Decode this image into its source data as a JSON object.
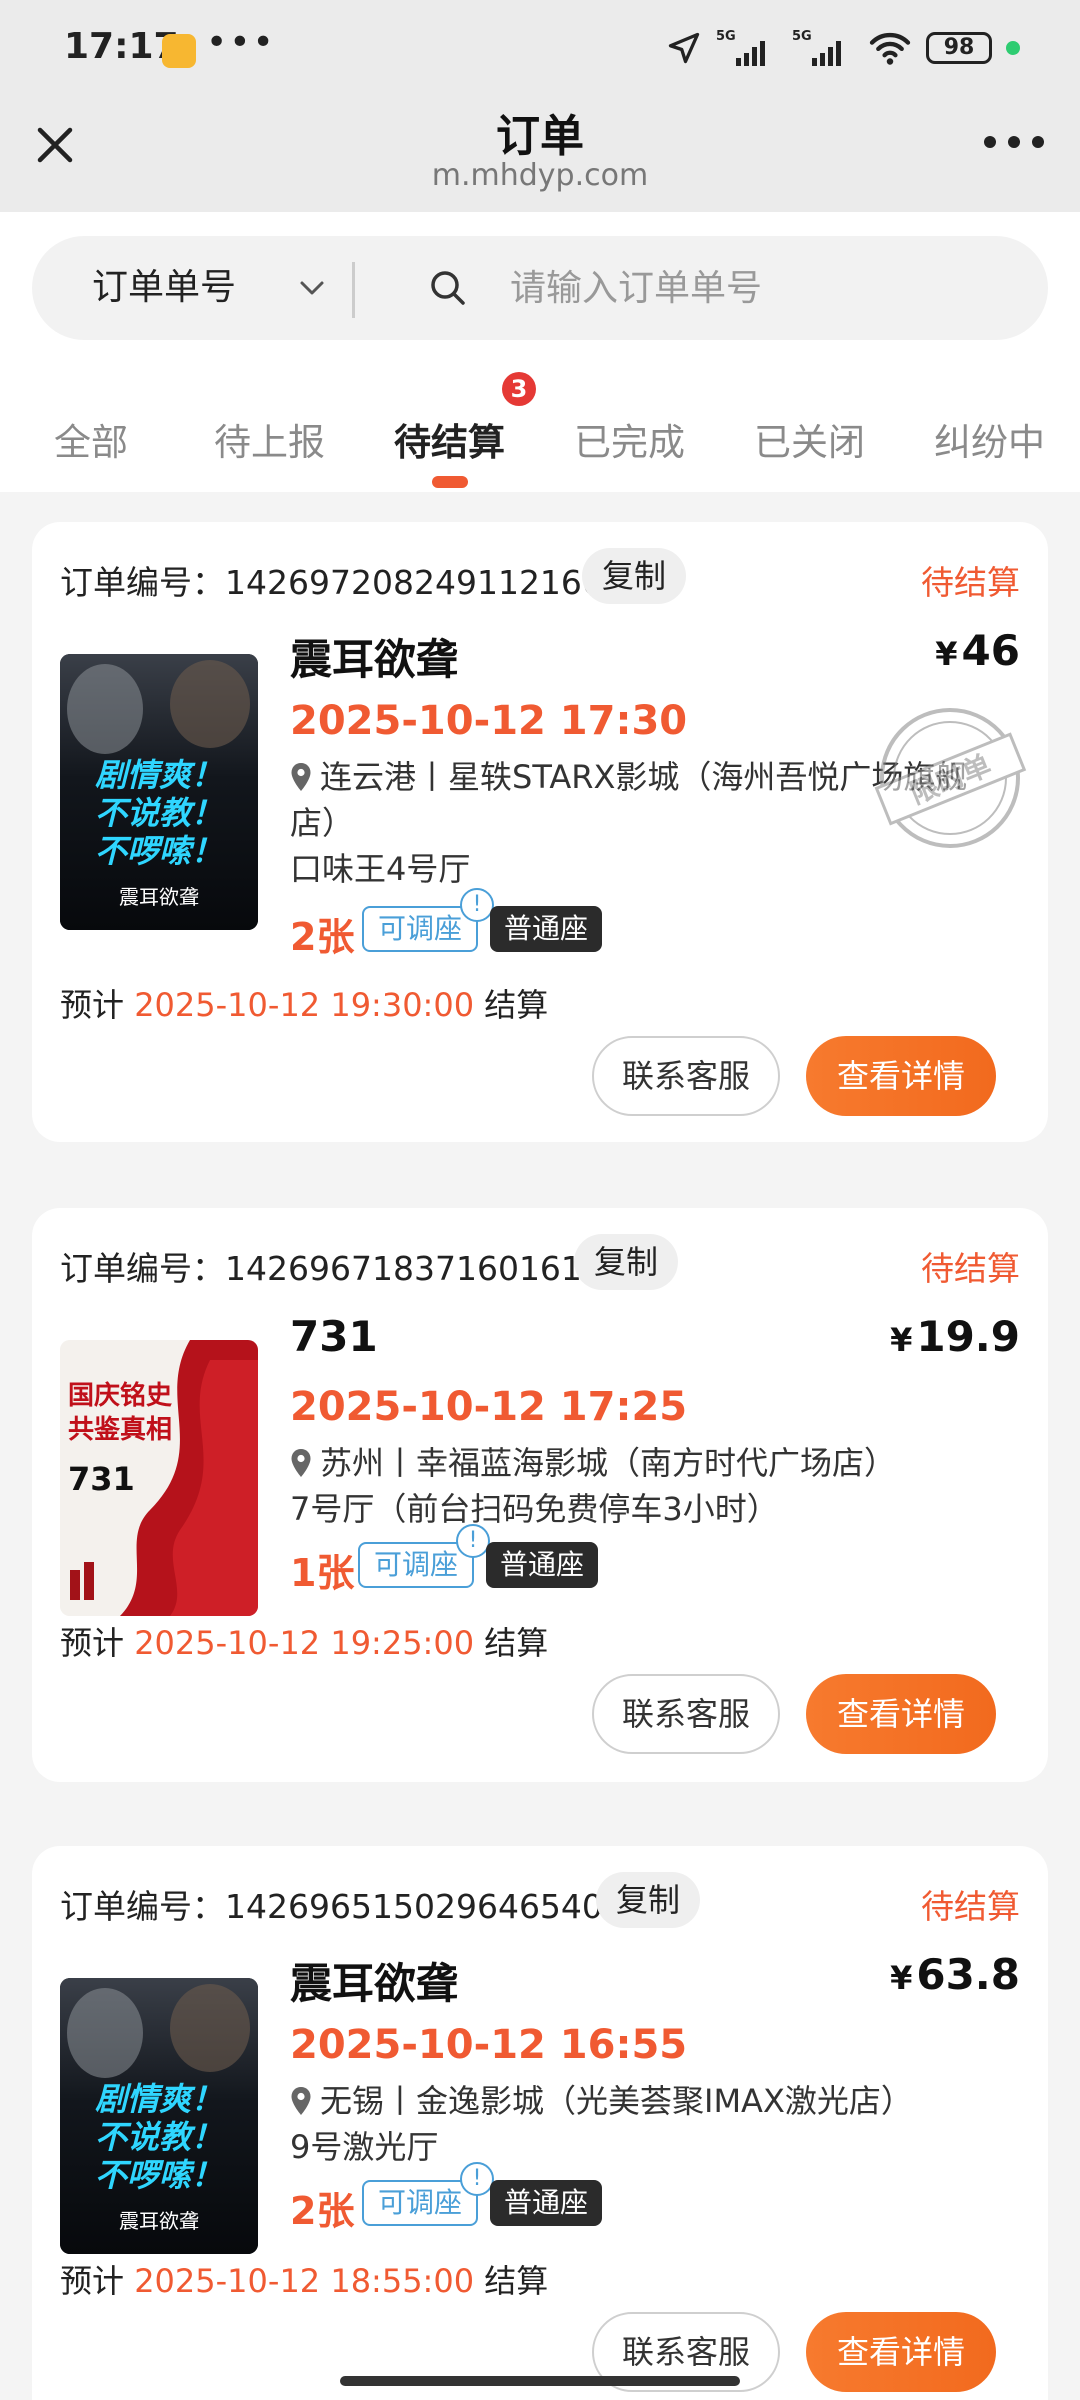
{
  "status_bar": {
    "time": "17:17",
    "battery": "98",
    "network_1": "5G",
    "network_2": "5G",
    "more_dots": "•••"
  },
  "nav": {
    "title": "订单",
    "url": "m.mhdyp.com"
  },
  "search": {
    "type_label": "订单单号",
    "placeholder": "请输入订单单号"
  },
  "tabs": [
    {
      "label": "全部"
    },
    {
      "label": "待上报"
    },
    {
      "label": "待结算",
      "badge": "3",
      "active": true
    },
    {
      "label": "已完成"
    },
    {
      "label": "已关闭"
    },
    {
      "label": "纠纷中"
    }
  ],
  "common": {
    "order_no_prefix": "订单编号：",
    "copy_label": "复制",
    "adjust_tag": "可调座",
    "info_mark": "!",
    "seat_tag": "普通座",
    "settle_prefix": "预计 ",
    "settle_suffix": " 结算",
    "contact_button": "联系客服",
    "detail_button": "查看详情",
    "currency": "¥"
  },
  "orders": [
    {
      "order_no": "1426972082491121665",
      "status": "待结算",
      "title": "震耳欲聋",
      "price": "46",
      "showtime": "2025-10-12 17:30",
      "cinema": "连云港丨星轶STARX影城（海州吾悦广场旗舰店）",
      "hall": "口味王4号厅",
      "tickets": "2张",
      "settle_time": "2025-10-12 19:30:00",
      "stamp": "限时单",
      "poster_lines": [
        "剧情爽！",
        "不说教！",
        "不啰嗦！"
      ],
      "poster_caption": "震耳欲聋"
    },
    {
      "order_no": "1426967183716016129",
      "status": "待结算",
      "title": "731",
      "price": "19.9",
      "showtime": "2025-10-12 17:25",
      "cinema": "苏州丨幸福蓝海影城（南方时代广场店）",
      "hall": "7号厅（前台扫码免费停车3小时）",
      "tickets": "1张",
      "settle_time": "2025-10-12 19:25:00",
      "poster_lines": [
        "国庆铭史",
        "共鉴真相"
      ],
      "poster_caption": "731"
    },
    {
      "order_no": "1426965150296465409",
      "status": "待结算",
      "title": "震耳欲聋",
      "price": "63.8",
      "showtime": "2025-10-12 16:55",
      "cinema": "无锡丨金逸影城（光美荟聚IMAX激光店）",
      "hall": "9号激光厅",
      "tickets": "2张",
      "settle_time": "2025-10-12 18:55:00",
      "poster_lines": [
        "剧情爽！",
        "不说教！",
        "不啰嗦！"
      ],
      "poster_caption": "震耳欲聋"
    }
  ],
  "colors": {
    "accent": "#f05a32",
    "tag_blue": "#4a9fd8",
    "button_orange": "#f77a2e"
  }
}
